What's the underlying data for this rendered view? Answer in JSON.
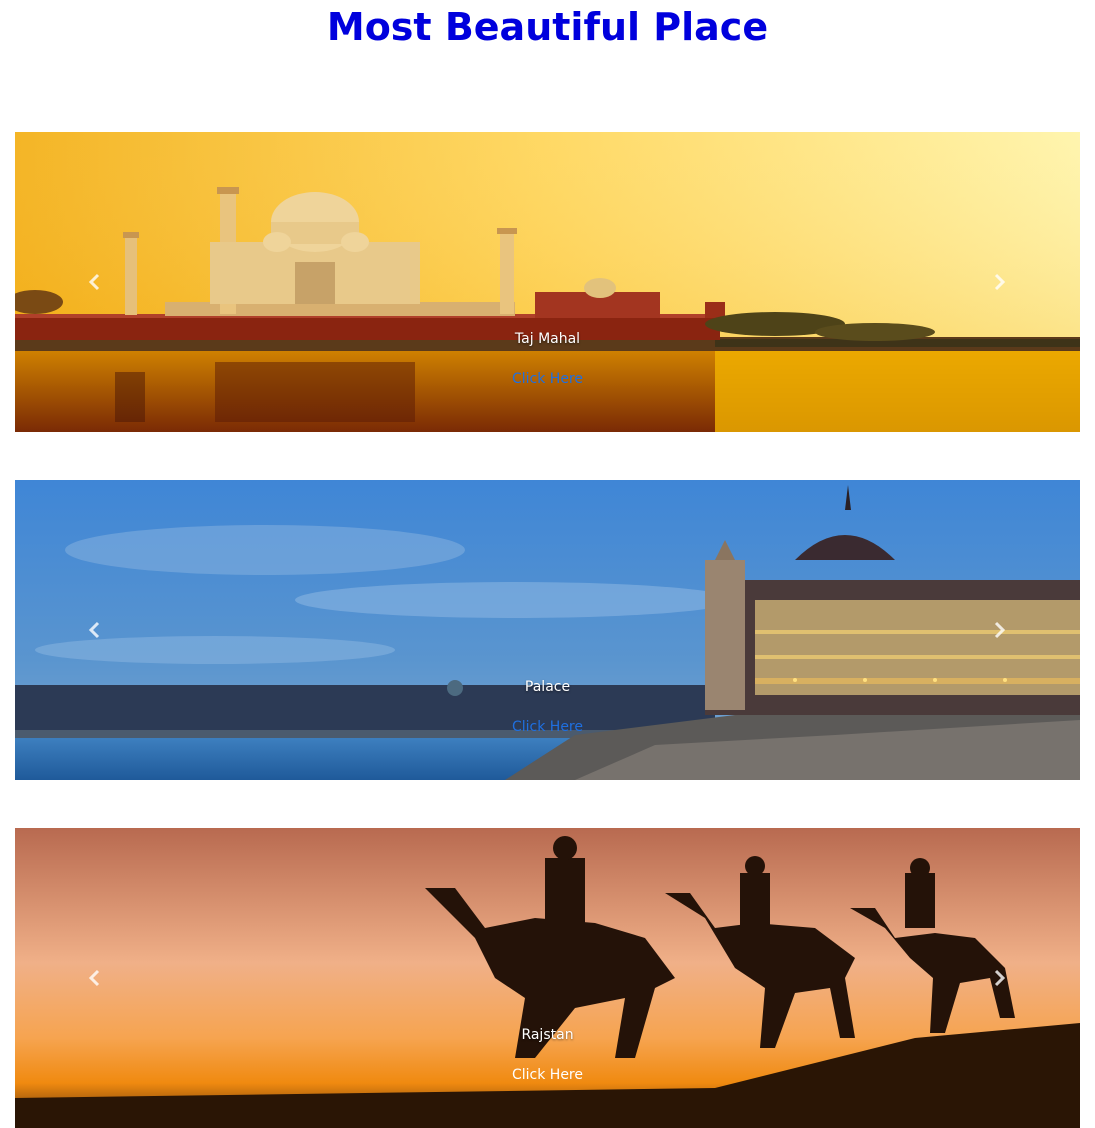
{
  "page": {
    "title": "Most Beautiful Place"
  },
  "slides": [
    {
      "caption": "Taj Mahal",
      "link": "Click Here",
      "link_color": "#1f6fe0",
      "prev_icon": "chevron-left-icon",
      "next_icon": "chevron-right-icon"
    },
    {
      "caption": "Palace",
      "link": "Click Here",
      "link_color": "#1f6fe0",
      "prev_icon": "chevron-left-icon",
      "next_icon": "chevron-right-icon"
    },
    {
      "caption": "Rajstan",
      "link": "Click Here",
      "link_color": "#ffffff",
      "prev_icon": "chevron-left-icon",
      "next_icon": "chevron-right-icon"
    }
  ],
  "colors": {
    "title": "#0000dd",
    "background": "#ffffff"
  }
}
